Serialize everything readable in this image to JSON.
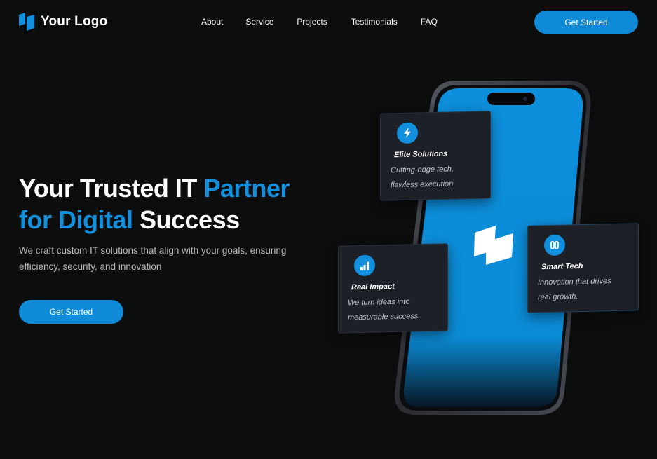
{
  "header": {
    "logo_text": "Your Logo",
    "logo_icon": "logo-mark-icon",
    "nav": [
      "About",
      "Service",
      "Projects",
      "Testimonials",
      "FAQ"
    ],
    "cta_label": "Get Started"
  },
  "hero": {
    "headline_part1": "Your Trusted IT ",
    "headline_accent1": "Partner",
    "headline_accent2": "for Digital",
    "headline_part2": " Success",
    "subtext": "We craft custom IT solutions that align with your goals, ensuring efficiency, security, and innovation",
    "cta_label": "Get Started"
  },
  "cards": {
    "elite": {
      "icon": "lightning-icon",
      "title": "Elite Solutions",
      "desc_line1": "Cutting-edge tech,",
      "desc_line2": "flawless execution"
    },
    "impact": {
      "icon": "bar-chart-icon",
      "title": "Real Impact",
      "desc_line1": "We turn ideas into",
      "desc_line2": "measurable success"
    },
    "smart": {
      "icon": "code-icon",
      "title": "Smart Tech",
      "desc_line1": "Innovation that drives",
      "desc_line2": "real growth."
    }
  },
  "colors": {
    "background": "#0c0d0d",
    "accent": "#1290de",
    "card_bg": "#1d2027",
    "muted_text": "#b9bcc0"
  }
}
